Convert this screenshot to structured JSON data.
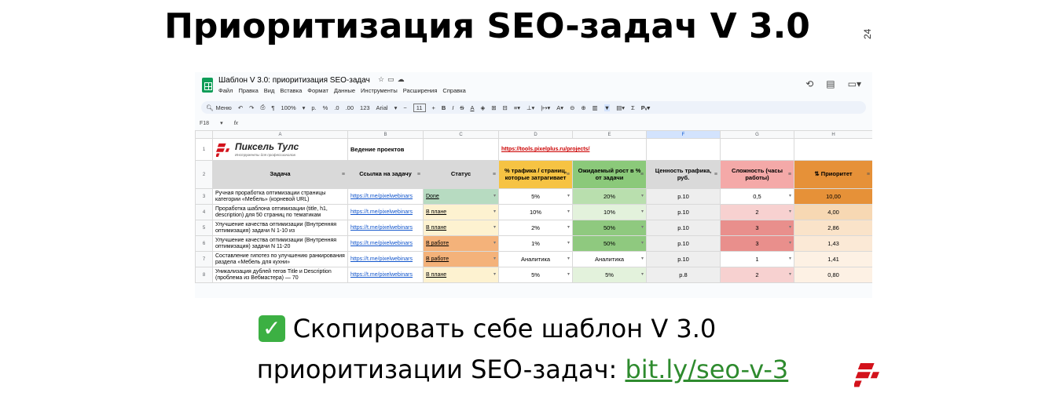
{
  "slide": {
    "title": "Приоритизация SEO-задач V 3.0",
    "page_number": "24",
    "cta_line1": "Скопировать себе шаблон V 3.0",
    "cta_line2_prefix": "приоритизации SEO-задач: ",
    "cta_link": "bit.ly/seo-v-3"
  },
  "sheet": {
    "doc_title": "Шаблон V 3.0: приоритизация SEO-задач",
    "menu": [
      "Файл",
      "Правка",
      "Вид",
      "Вставка",
      "Формат",
      "Данные",
      "Инструменты",
      "Расширения",
      "Справка"
    ],
    "toolbar": {
      "search": "Меню",
      "zoom": "100%",
      "currency": "р.",
      "percent": "%",
      "dec_minus": ".0",
      "dec_plus": ".00",
      "format": "123",
      "font": "Arial",
      "font_size": "11"
    },
    "cell_ref": "F18",
    "fx": "fx",
    "columns": [
      "A",
      "B",
      "C",
      "D",
      "E",
      "F",
      "G",
      "H"
    ],
    "brand": {
      "name": "Пиксель Тулс",
      "tagline": "Инструменты для профессионалов"
    },
    "row1": {
      "b": "Ведение проектов",
      "d": "https://tools.pixelplus.ru/projects/"
    },
    "headers": [
      "Задача",
      "Ссылка на задачу",
      "Статус",
      "% трафика / страниц, которые затрагивает",
      "Ожидаемый рост в % от задачи",
      "Ценность трафика, руб.",
      "Сложность (часы работы)",
      "Приоритет"
    ],
    "rows": [
      {
        "n": "3",
        "task": "Ручная проработка оптимизации страницы категории «Мебель» (корневой URL)",
        "link": "https://t.me/pixelwebinars",
        "status": "Done",
        "traffic": "5%",
        "growth": "20%",
        "value": "р.10",
        "complexity": "0,5",
        "priority": "10,00"
      },
      {
        "n": "4",
        "task": "Проработка шаблона оптимизации (title, h1, description) для 50 страниц по тематикам",
        "link": "https://t.me/pixelwebinars",
        "status": "В плане",
        "traffic": "10%",
        "growth": "10%",
        "value": "р.10",
        "complexity": "2",
        "priority": "4,00"
      },
      {
        "n": "5",
        "task": "Улучшение качества оптимизации (Внутренняя оптимизация) задачи N 1-10 из",
        "link": "https://t.me/pixelwebinars",
        "status": "В плане",
        "traffic": "2%",
        "growth": "50%",
        "value": "р.10",
        "complexity": "3",
        "priority": "2,86"
      },
      {
        "n": "6",
        "task": "Улучшение качества оптимизации (Внутренняя оптимизация) задачи N 11-20",
        "link": "https://t.me/pixelwebinars",
        "status": "В работе",
        "traffic": "1%",
        "growth": "50%",
        "value": "р.10",
        "complexity": "3",
        "priority": "1,43"
      },
      {
        "n": "7",
        "task": "Составление гипотез по улучшению ранкирования раздела «Мебель для кухни»",
        "link": "https://t.me/pixelwebinars",
        "status": "В работе",
        "traffic": "Аналитика",
        "growth": "Аналитика",
        "value": "р.10",
        "complexity": "1",
        "priority": "1,41"
      },
      {
        "n": "8",
        "task": "Уникализация дублей тегов Title и Description (проблема из Вебмастера) — 70",
        "link": "https://t.me/pixelwebinars",
        "status": "В плане",
        "traffic": "5%",
        "growth": "5%",
        "value": "р.8",
        "complexity": "2",
        "priority": "0,80"
      }
    ],
    "colors": {
      "green": "#0f9d58",
      "link": "#1155cc",
      "brand_red": "#d3121b"
    }
  }
}
